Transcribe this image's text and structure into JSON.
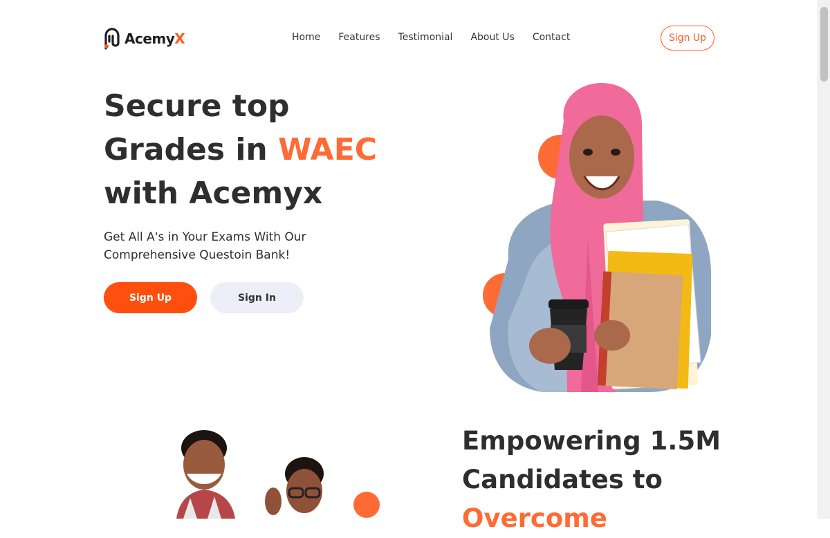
{
  "brand": {
    "name_main": "Acemy",
    "name_accent": "X"
  },
  "nav": {
    "items": [
      "Home",
      "Features",
      "Testimonial",
      "About Us",
      "Contact"
    ]
  },
  "header": {
    "signup_label": "Sign Up"
  },
  "hero": {
    "title_line1": "Secure top",
    "title_line2_pre": "Grades in ",
    "title_line2_accent": "WAEC",
    "title_line3": "with Acemyx",
    "subtitle": "Get All A's in Your Exams With Our Comprehensive Questoin Bank!",
    "primary_button": "Sign Up",
    "secondary_button": "Sign In"
  },
  "section2": {
    "title_line1": "Empowering 1.5M",
    "title_line2": "Candidates to",
    "title_line3_accent": "Overcome"
  },
  "colors": {
    "accent": "#ff5a1f",
    "text": "#2e2e2e",
    "secondary_button_bg": "#eeeef8"
  },
  "icons": {
    "logo": "acemyx-logo-mark",
    "hero_image": "student-with-books-photo",
    "section_image": "students-photo"
  }
}
